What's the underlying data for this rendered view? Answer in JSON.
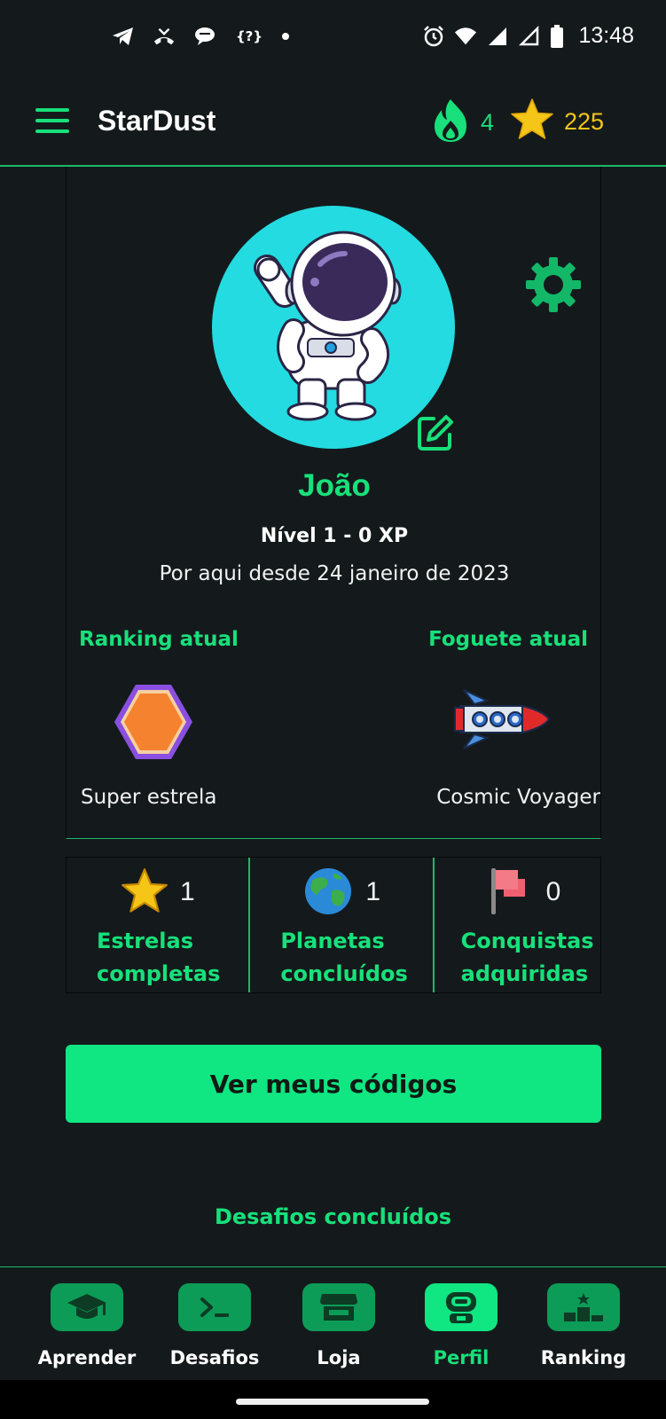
{
  "status_bar": {
    "time": "13:48",
    "left_icons": [
      "telegram-icon",
      "missed-call-icon",
      "chat-bubble-icon",
      "code-icon",
      "dot-icon"
    ],
    "right_icons": [
      "alarm-icon",
      "wifi-icon",
      "signal-icon",
      "signal-empty-icon",
      "battery-icon"
    ],
    "code_glyph": "{?}"
  },
  "header": {
    "title": "StarDust",
    "streak_count": "4",
    "star_count": "225"
  },
  "profile": {
    "name": "João",
    "level": "Nível 1 - 0 XP",
    "member_since": "Por aqui desde 24 janeiro de 2023",
    "ranking_title": "Ranking atual",
    "ranking_name": "Super estrela",
    "rocket_title": "Foguete atual",
    "rocket_name": "Cosmic Voyager"
  },
  "stats": [
    {
      "value": "1",
      "label_line1": "Estrelas",
      "label_line2": "completas",
      "icon": "star-icon"
    },
    {
      "value": "1",
      "label_line1": "Planetas",
      "label_line2": "concluídos",
      "icon": "planet-icon"
    },
    {
      "value": "0",
      "label_line1": "Conquistas",
      "label_line2": "adquiridas",
      "icon": "flag-icon"
    }
  ],
  "codes_button": "Ver meus códigos",
  "challenges_title": "Desafios concluídos",
  "nav": [
    {
      "label": "Aprender",
      "icon": "graduation-cap-icon"
    },
    {
      "label": "Desafios",
      "icon": "terminal-icon"
    },
    {
      "label": "Loja",
      "icon": "store-icon"
    },
    {
      "label": "Perfil",
      "icon": "astronaut-icon",
      "active": true
    },
    {
      "label": "Ranking",
      "icon": "podium-icon"
    }
  ],
  "colors": {
    "background": "#141a1c",
    "accent": "#18e07a",
    "button": "#10e682",
    "star": "#f5c518",
    "avatar_bg": "#23dbe0"
  }
}
